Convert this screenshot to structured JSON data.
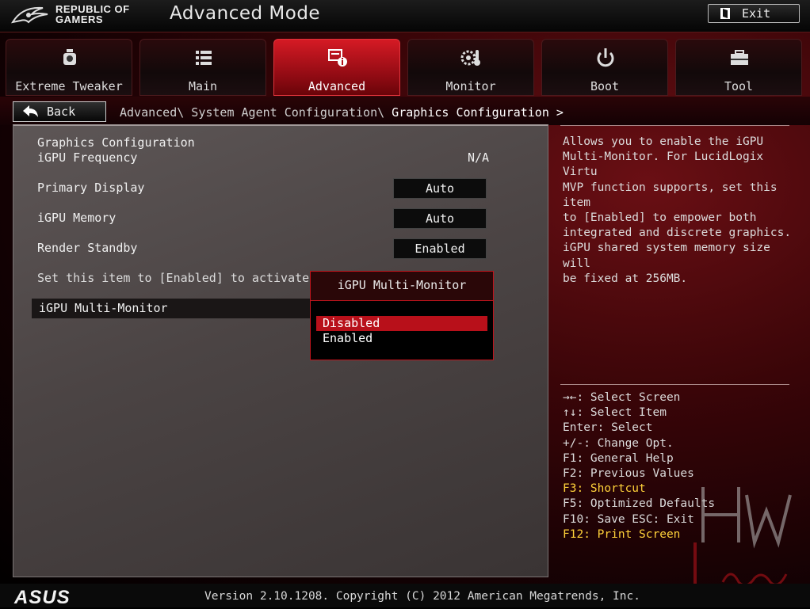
{
  "header": {
    "brand_line1": "REPUBLIC OF",
    "brand_line2": "GAMERS",
    "title": "Advanced Mode",
    "exit_label": "Exit"
  },
  "tabs": [
    {
      "label": "Extreme Tweaker",
      "icon": "gauge-icon",
      "active": false
    },
    {
      "label": "Main",
      "icon": "list-icon",
      "active": false
    },
    {
      "label": "Advanced",
      "icon": "advanced-info-icon",
      "active": true
    },
    {
      "label": "Monitor",
      "icon": "thermometer-gear-icon",
      "active": false
    },
    {
      "label": "Boot",
      "icon": "power-icon",
      "active": false
    },
    {
      "label": "Tool",
      "icon": "toolbox-icon",
      "active": false
    }
  ],
  "nav": {
    "back_label": "Back",
    "breadcrumb_path": "Advanced\\ System Agent Configuration\\ ",
    "breadcrumb_current": "Graphics Configuration >"
  },
  "settings": {
    "section_title": "Graphics Configuration",
    "igpu_frequency_label": "iGPU Frequency",
    "igpu_frequency_value": "N/A",
    "primary_display_label": "Primary Display",
    "primary_display_value": "Auto",
    "igpu_memory_label": "iGPU Memory",
    "igpu_memory_value": "Auto",
    "render_standby_label": "Render Standby",
    "render_standby_value": "Enabled",
    "note_text": "Set this item to [Enabled] to activate Luci",
    "multi_monitor_label": "iGPU Multi-Monitor"
  },
  "popup": {
    "title": "iGPU Multi-Monitor",
    "options": [
      "Disabled",
      "Enabled"
    ],
    "selected": "Disabled"
  },
  "help": {
    "lines": [
      "Allows you to enable the iGPU",
      "Multi-Monitor. For LucidLogix Virtu",
      "MVP function supports, set this item",
      "to [Enabled] to empower both",
      "integrated and discrete graphics.",
      "iGPU shared system memory size will",
      "be fixed at 256MB."
    ]
  },
  "keys": {
    "k1": "→←: Select Screen",
    "k2": "↑↓: Select Item",
    "k3": "Enter: Select",
    "k4": "+/-: Change Opt.",
    "k5": "F1: General Help",
    "k6": "F2: Previous Values",
    "k7": "F3: Shortcut",
    "k8": "F5: Optimized Defaults",
    "k9": "F10: Save  ESC: Exit",
    "k10": "F12: Print Screen"
  },
  "footer": {
    "brand": "ASUS",
    "version": "Version 2.10.1208. Copyright (C) 2012 American Megatrends, Inc."
  },
  "colors": {
    "accent_red": "#d51a24",
    "shortcut_yellow": "#ffd23a"
  }
}
